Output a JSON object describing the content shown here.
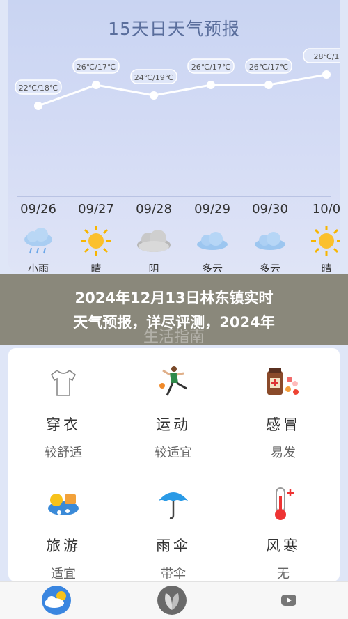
{
  "forecast": {
    "title": "15天日天气预报",
    "temps": [
      "22℃/18℃",
      "26℃/17℃",
      "24℃/19℃",
      "26℃/17℃",
      "26℃/17℃",
      "28℃/1"
    ],
    "days": [
      {
        "date": "09/26",
        "condition": "小雨",
        "icon": "rain-cloud-icon"
      },
      {
        "date": "09/27",
        "condition": "晴",
        "icon": "sun-icon"
      },
      {
        "date": "09/28",
        "condition": "阴",
        "icon": "overcast-cloud-icon"
      },
      {
        "date": "09/29",
        "condition": "多云",
        "icon": "cloudy-icon"
      },
      {
        "date": "09/30",
        "condition": "多云",
        "icon": "cloudy-icon"
      },
      {
        "date": "10/0",
        "condition": "晴",
        "icon": "sun-icon"
      }
    ]
  },
  "banner": {
    "line1": "2024年12月13日林东镇实时",
    "line2": "天气预报，详尽评测，2024年"
  },
  "guide": {
    "title": "生活指南"
  },
  "life_items": [
    {
      "label": "穿衣",
      "value": "较舒适",
      "icon": "tshirt-icon"
    },
    {
      "label": "运动",
      "value": "较适宜",
      "icon": "runner-icon"
    },
    {
      "label": "感冒",
      "value": "易发",
      "icon": "medicine-icon"
    },
    {
      "label": "旅游",
      "value": "适宜",
      "icon": "travel-icon"
    },
    {
      "label": "雨伞",
      "value": "带伞",
      "icon": "umbrella-icon"
    },
    {
      "label": "风寒",
      "value": "无",
      "icon": "thermometer-icon"
    }
  ],
  "nav": {
    "items": [
      "weather-nav-icon",
      "leaf-nav-icon",
      "video-nav-icon"
    ]
  },
  "colors": {
    "title": "#5a6e9c",
    "line": "#ffffff",
    "sun": "#f7b500",
    "cloud": "#a9cdf2"
  }
}
